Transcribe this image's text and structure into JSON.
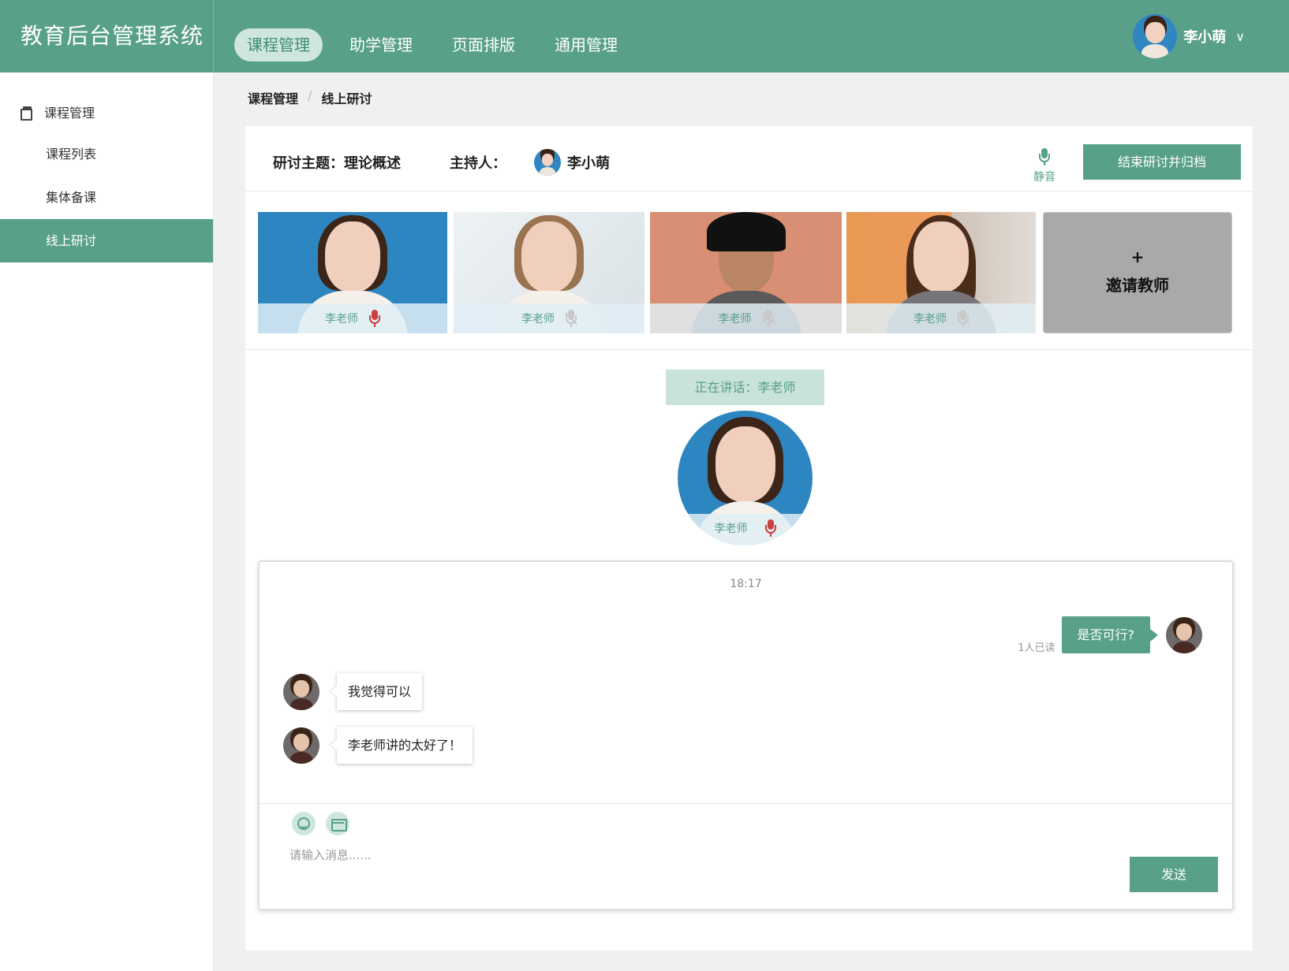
{
  "app": {
    "title": "教育后台管理系统"
  },
  "nav": {
    "items": [
      {
        "label": "课程管理",
        "active": true
      },
      {
        "label": "助学管理",
        "active": false
      },
      {
        "label": "页面排版",
        "active": false
      },
      {
        "label": "通用管理",
        "active": false
      }
    ]
  },
  "user": {
    "name": "李小萌",
    "chevron": "∨"
  },
  "sidebar": {
    "section": {
      "label": "课程管理",
      "icon": "book-icon"
    },
    "items": [
      {
        "label": "课程列表",
        "active": false
      },
      {
        "label": "集体备课",
        "active": false
      },
      {
        "label": "线上研讨",
        "active": true
      }
    ]
  },
  "breadcrumb": {
    "items": [
      "课程管理",
      "线上研讨"
    ],
    "separator": "/"
  },
  "discussion": {
    "topic": "研讨主题：理论概述",
    "host_label": "主持人：",
    "host_name": "李小萌",
    "mute_label": "静音",
    "end_button": "结束研讨并归档"
  },
  "participants": [
    {
      "name": "李老师",
      "mic": "on"
    },
    {
      "name": "李老师",
      "mic": "off"
    },
    {
      "name": "李老师",
      "mic": "off"
    },
    {
      "name": "李老师",
      "mic": "off"
    }
  ],
  "invite": {
    "plus": "+",
    "label": "邀请教师"
  },
  "speaking": {
    "label": "正在讲话：李老师",
    "name": "李老师"
  },
  "chat": {
    "time": "18:17",
    "messages": [
      {
        "side": "right",
        "text": "是否可行?",
        "status": "1人已读"
      },
      {
        "side": "left",
        "text": "我觉得可以"
      },
      {
        "side": "left",
        "text": "李老师讲的太好了！"
      }
    ],
    "placeholder": "请输入消息......",
    "send_label": "发送"
  },
  "colors": {
    "primary": "#58a08a",
    "primary_light": "#cfe6df",
    "mic_on": "#c94040"
  }
}
